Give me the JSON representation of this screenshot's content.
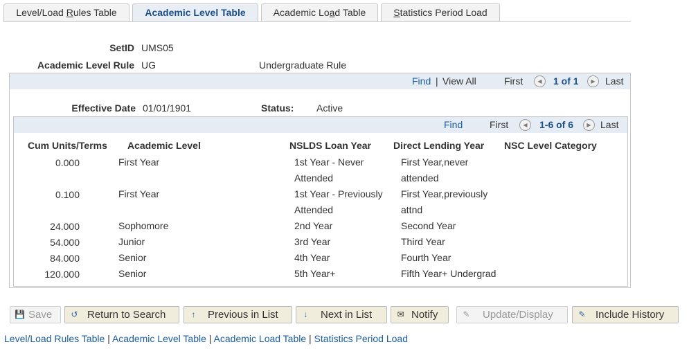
{
  "tabs": [
    {
      "pre": "Level/Load ",
      "ul": "R",
      "post": "ules Table"
    },
    {
      "pre": "Academic Level Table",
      "ul": "",
      "post": ""
    },
    {
      "pre": "Academic Lo",
      "ul": "a",
      "post": "d Table"
    },
    {
      "pre": "",
      "ul": "S",
      "post": "tatistics Period Load"
    }
  ],
  "header": {
    "setid_label": "SetID",
    "setid_value": "UMS05",
    "rule_label": "Academic Level Rule",
    "rule_value": "UG",
    "rule_desc": "Undergraduate Rule"
  },
  "outer_nav": {
    "find": "Find",
    "sep": "|",
    "view_all": "View All",
    "first": "First",
    "count": "1 of 1",
    "last": "Last"
  },
  "effective": {
    "date_label": "Effective Date",
    "date_value": "01/01/1901",
    "status_label": "Status:",
    "status_value": "Active"
  },
  "inner_nav": {
    "find": "Find",
    "first": "First",
    "count": "1-6 of 6",
    "last": "Last"
  },
  "grid": {
    "columns": [
      "Cum Units/Terms",
      "Academic Level",
      "NSLDS Loan Year",
      "Direct Lending Year",
      "NSC Level Category"
    ],
    "rows": [
      {
        "units": "0.000",
        "level": "First Year",
        "nslds1": "1st Year - Never",
        "nslds2": "Attended",
        "dl1": "First Year,never",
        "dl2": "attended"
      },
      {
        "units": "0.100",
        "level": "First Year",
        "nslds1": "1st Year - Previously",
        "nslds2": "Attended",
        "dl1": "First Year,previously",
        "dl2": "attnd"
      },
      {
        "units": "24.000",
        "level": "Sophomore",
        "nslds1": "2nd Year",
        "nslds2": "",
        "dl1": "Second Year",
        "dl2": ""
      },
      {
        "units": "54.000",
        "level": "Junior",
        "nslds1": "3rd Year",
        "nslds2": "",
        "dl1": "Third Year",
        "dl2": ""
      },
      {
        "units": "84.000",
        "level": "Senior",
        "nslds1": "4th Year",
        "nslds2": "",
        "dl1": "Fourth Year",
        "dl2": ""
      },
      {
        "units": "120.000",
        "level": "Senior",
        "nslds1": "5th Year+",
        "nslds2": "",
        "dl1": "Fifth Year+ Undergrad",
        "dl2": ""
      }
    ]
  },
  "toolbar": {
    "save": "Save",
    "return_to_search": "Return to Search",
    "previous_in_list": "Previous in List",
    "next_in_list": "Next in List",
    "notify": "Notify",
    "update_display": "Update/Display",
    "include_history": "Include History"
  },
  "bottom_links": [
    "Level/Load Rules Table",
    "Academic Level Table",
    "Academic Load Table",
    "Statistics Period Load"
  ],
  "colors": {
    "link": "#1b5d9c",
    "bar": "#e5ecf3",
    "button": "#f1eddc"
  },
  "icons": [
    "save-icon",
    "return-to-search-icon",
    "previous-in-list-icon",
    "next-in-list-icon",
    "notify-icon",
    "update-display-icon",
    "include-history-icon",
    "first-arrow-icon",
    "last-arrow-icon"
  ]
}
